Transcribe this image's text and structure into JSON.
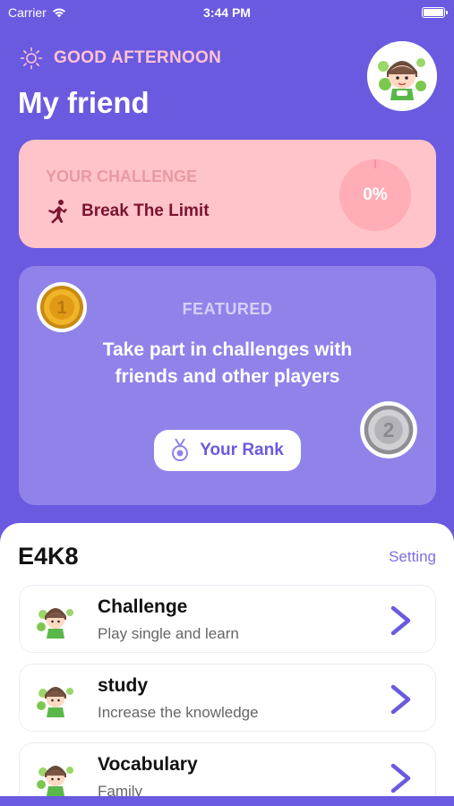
{
  "status_bar": {
    "carrier": "Carrier",
    "time": "3:44 PM"
  },
  "header": {
    "greeting": "GOOD AFTERNOON",
    "title": "My friend"
  },
  "challenge_card": {
    "kicker": "YOUR CHALLENGE",
    "name": "Break The Limit",
    "progress_label": "0%",
    "progress_value": 0
  },
  "featured_card": {
    "kicker": "FEATURED",
    "text": "Take part in challenges with friends and other players",
    "rank_button": "Your Rank",
    "medal_gold_number": "1",
    "medal_silver_number": "2"
  },
  "section": {
    "title": "E4K8",
    "setting_label": "Setting"
  },
  "menu_items": [
    {
      "title": "Challenge",
      "subtitle": "Play single and learn"
    },
    {
      "title": "study",
      "subtitle": "Increase the knowledge"
    },
    {
      "title": "Vocabulary",
      "subtitle": "Family"
    }
  ],
  "icons": {
    "wifi": "wifi-icon",
    "battery": "battery-icon",
    "sun": "sun-icon",
    "runner": "runner-icon",
    "medal": "medal-icon",
    "chevron": "chevron-right-icon"
  },
  "colors": {
    "background": "#6a5ae0",
    "challenge_card": "#ffc4c9",
    "featured_card": "#8f83ea",
    "accent": "#7b6fe1",
    "challenge_text": "#7a1430"
  }
}
